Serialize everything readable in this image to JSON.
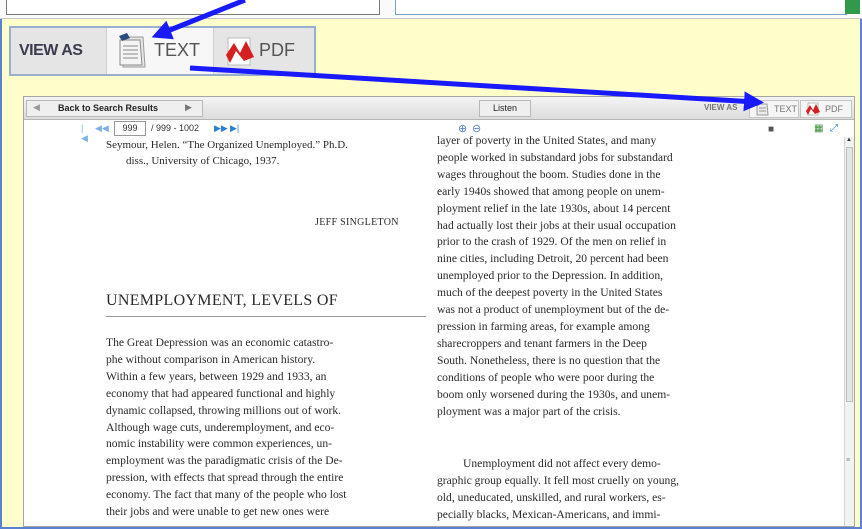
{
  "viewas_big": {
    "label": "VIEW AS",
    "text_label": "TEXT",
    "pdf_label": "PDF"
  },
  "toolbar": {
    "back_label": "Back to Search Results",
    "listen_label": "Listen",
    "viewas_label": "VIEW AS",
    "text_label": "TEXT",
    "pdf_label": "PDF"
  },
  "pager": {
    "current_page": "999",
    "total": "/ 999 - 1002"
  },
  "document": {
    "reference_lines": [
      "Seymour, Helen. “The Organized Unemployed.” Ph.D.",
      "diss., University of Chicago, 1937."
    ],
    "author": "JEFF SINGLETON",
    "heading": "UNEMPLOYMENT, LEVELS OF",
    "left_column": [
      "The Great Depression was an economic catastro-",
      "phe without comparison in American history.",
      "Within a few years, between 1929 and 1933, an",
      "economy that had appeared functional and highly",
      "dynamic collapsed, throwing millions out of work.",
      "Although wage cuts, underemployment, and eco-",
      "nomic instability were common experiences, un-",
      "employment was the paradigmatic crisis of the De-",
      "pression, with effects that spread through the entire",
      "economy. The fact that many of the people who lost",
      "their jobs and were unable to get new ones were"
    ],
    "right_column": [
      "layer of poverty in the United States, and many",
      "people worked in substandard jobs for substandard",
      "wages throughout the boom. Studies done in the",
      "early 1940s showed that among people on unem-",
      "ployment relief in the late 1930s, about 14 percent",
      "had actually lost their jobs at their usual occupation",
      "prior to the crash of 1929. Of the men on relief in",
      "nine cities, including Detroit, 20 percent had been",
      "unemployed prior to the Depression. In addition,",
      "much of the deepest poverty in the United States",
      "was not a product of unemployment but of the de-",
      "pression in farming areas, for example among",
      "sharecroppers and tenant farmers in the Deep",
      "South. Nonetheless, there is no question that the",
      "conditions of people who were poor during the",
      "boom only worsened during the 1930s, and unem-",
      "ployment was a major part of the crisis."
    ],
    "right_column_2": [
      "Unemployment did not affect every demo-",
      "graphic group equally. It fell most cruelly on young,",
      "old, uneducated, unskilled, and rural workers, es-",
      "pecially blacks, Mexican-Americans, and immi-"
    ]
  },
  "colors": {
    "arrow": "#1a1aff",
    "frame": "#5b7fd1",
    "background": "#ffffcc",
    "pdf_red": "#d42020"
  }
}
